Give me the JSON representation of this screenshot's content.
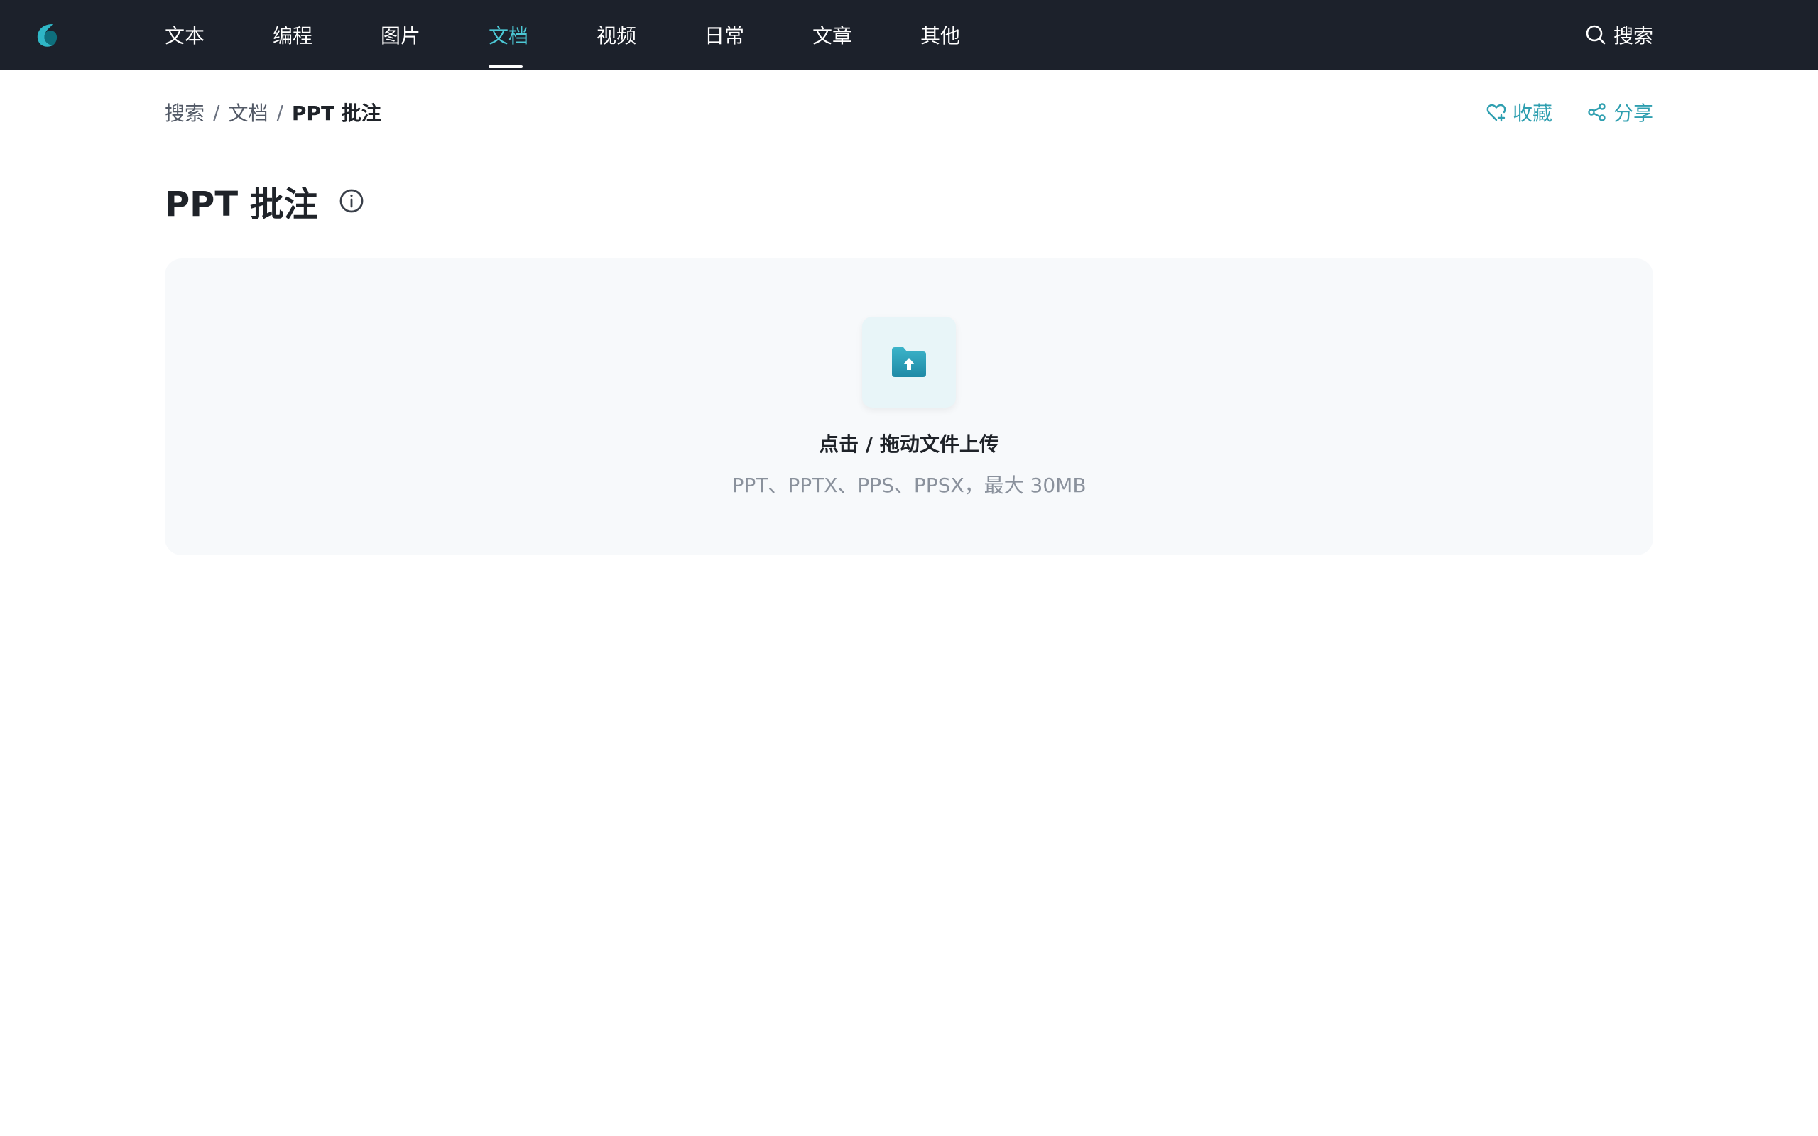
{
  "nav": {
    "logo_icon": "leaf-logo-icon",
    "items": [
      {
        "label": "文本"
      },
      {
        "label": "编程"
      },
      {
        "label": "图片"
      },
      {
        "label": "文档",
        "active": true
      },
      {
        "label": "视频"
      },
      {
        "label": "日常"
      },
      {
        "label": "文章"
      },
      {
        "label": "其他"
      }
    ],
    "search_label": "搜索",
    "search_icon": "search-icon"
  },
  "breadcrumb": {
    "items": [
      "搜索",
      "文档"
    ],
    "separator": "/",
    "current": "PPT 批注"
  },
  "actions": {
    "favorite_label": "收藏",
    "favorite_icon": "heart-plus-icon",
    "share_label": "分享",
    "share_icon": "share-icon"
  },
  "page": {
    "title": "PPT 批注",
    "info_icon": "info-icon"
  },
  "upload": {
    "icon": "folder-upload-icon",
    "title": "点击 / 拖动文件上传",
    "hint": "PPT、PPTX、PPS、PPSX，最大 30MB"
  },
  "colors": {
    "topbar_bg": "#1c212b",
    "accent": "#2f9fb0",
    "nav_active": "#4cc9d6",
    "upload_bg": "#f7f9fb"
  }
}
